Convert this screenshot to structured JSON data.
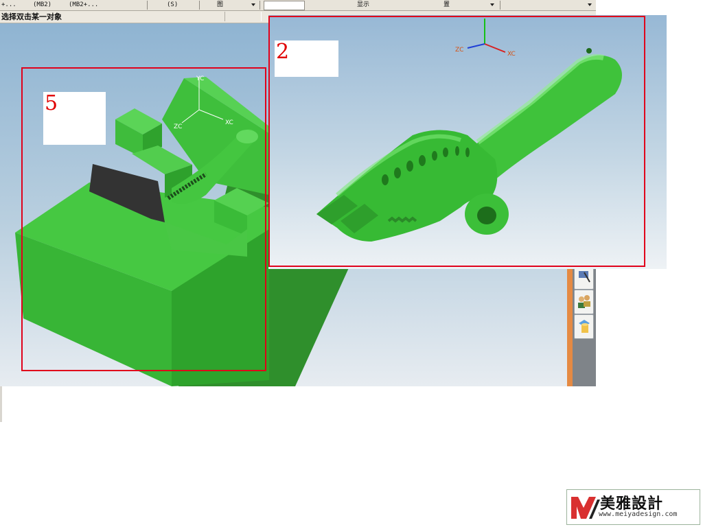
{
  "toolbar": {
    "item1": "+...",
    "item2": "(MB2)",
    "item3": "(MB2+...",
    "item4": "(S)",
    "item5": "图",
    "display_label": "显示",
    "view_label": "置"
  },
  "status": {
    "prompt": "选择双击某一对象"
  },
  "figures": {
    "left_label": "5",
    "right_label": "2"
  },
  "axes": {
    "xc": "XC",
    "zc": "ZC",
    "yc": "YC"
  },
  "watermark": {
    "brand_cn": "美雅設計",
    "url": "www.meiyadesign.com"
  },
  "colors": {
    "part_green": "#39c23a",
    "frame_red": "#e0001a",
    "accent_orange": "#e58a43"
  }
}
